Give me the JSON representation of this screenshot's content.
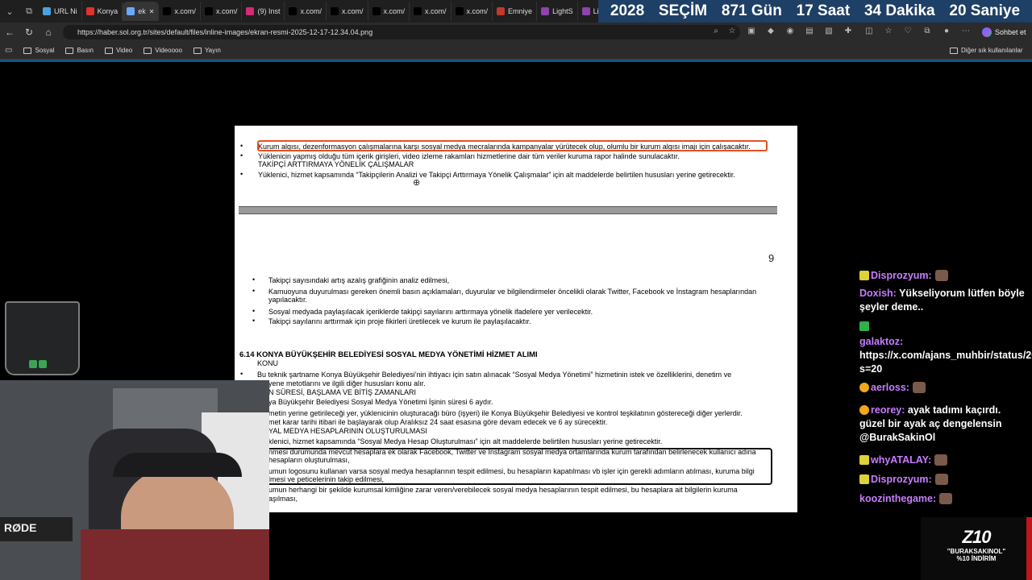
{
  "tabs": [
    {
      "label": "URL Ni",
      "color": "#4aa3df"
    },
    {
      "label": "Konya",
      "color": "#e0312e"
    },
    {
      "label": "ek",
      "color": "#6aa8ff",
      "active": true
    },
    {
      "label": "x.com/",
      "color": "#000000"
    },
    {
      "label": "x.com/",
      "color": "#000000"
    },
    {
      "label": "(9) Inst",
      "color": "#d62976"
    },
    {
      "label": "x.com/",
      "color": "#000000"
    },
    {
      "label": "x.com/",
      "color": "#000000"
    },
    {
      "label": "x.com/",
      "color": "#000000"
    },
    {
      "label": "x.com/",
      "color": "#000000"
    },
    {
      "label": "x.com/",
      "color": "#000000"
    },
    {
      "label": "Emniye",
      "color": "#c0392b"
    },
    {
      "label": "LightS",
      "color": "#8e44ad"
    },
    {
      "label": "LightS",
      "color": "#8e44ad"
    },
    {
      "label": "x",
      "color": "#8e44ad"
    }
  ],
  "countdown": {
    "year": "2028",
    "label": "SEÇİM",
    "days": "871 Gün",
    "hours": "17 Saat",
    "minutes": "34 Dakika",
    "seconds": "20 Saniye"
  },
  "url": "https://haber.sol.org.tr/sites/default/files/inline-images/ekran-resmi-2025-12-17-12.34.04.png",
  "chat_button": "Sohbet et",
  "bookmarks": {
    "items": [
      "Sosyal",
      "Basın",
      "Video",
      "Videoooo",
      "Yayın"
    ],
    "other": "Diğer sık kullanılanlar"
  },
  "doc": {
    "top_lines": [
      "Kurum algısı, dezenformasyon çalışmalarına karşı sosyal medya mecralarında kampanyalar yürütecek olup, olumlu bir kurum algısı imajı için çalışacaktır.",
      "Yüklenicin yapmış olduğu tüm içerik girişleri, video izleme rakamları hizmetlerine dair tüm veriler kuruma rapor halinde sunulacaktır.",
      "TAKİPÇİ ARTTIRMAYA YÖNELİK ÇALIŞMALAR",
      "Yüklenici, hizmet kapsamında “Takipçilerin Analizi ve Takipçi Arttırmaya Yönelik Çalışmalar” için alt maddelerde belirtilen hususları yerine getirecektir."
    ],
    "page_number": "9",
    "follower_items": [
      "Takipçi sayısındaki artış azalış grafiğinin analiz edilmesi,",
      "Kamuoyuna duyurulması gereken önemli basın açıklamaları, duyurular ve bilgilendirmeler öncelikli olarak Twitter, Facebook ve İnstagram hesaplarından",
      "yapılacaktır.",
      "Sosyal medyada paylaşılacak içeriklerde takipçi sayılarını arttırmaya yönelik ifadelere yer verilecektir.",
      "Takipçi sayılarını arttırmak için proje fikirleri üretilecek ve kurum ile paylaşılacaktır."
    ],
    "section_title": "6.14 KONYA BÜYÜKŞEHİR BELEDİYESİ SOSYAL MEDYA YÖNETİMİ HİZMET ALIMI",
    "section_lines": [
      "KONU",
      "Bu teknik şartname Konya Büyükşehir Belediyesi’nin ihtiyacı için satın alınacak “Sosyal Medya Yönetimi” hizmetinin istek ve özelliklerini, denetim ve",
      "yene metotlarını ve ilgili diğer hususları konu alır.",
      "N SÜRESİ, BAŞLAMA VE BİTİŞ ZAMANLARI",
      "ya Büyükşehir Belediyesi Sosyal Medya Yönetimi İşinin süresi 6 aydır.",
      "metin yerine getirileceği yer, yüklenicinin oluşturacağı büro (işyeri) ile Konya Büyükşehir Belediyesi ve kontrol teşkilatının göstereceği diğer yerlerdir.",
      "met karar tarihi itibari ile başlayarak olup Aralıksız 24 saat esasına göre devam edecek ve 6 ay sürecektir.",
      "YAL MEDYA HESAPLARININ OLUŞTURULMASI",
      "klenici, hizmet kapsamında “Sosyal Medya Hesap Oluşturulması” için alt maddelerde belirtilen hususları yerine getirecektir.",
      "nmesi durumunda mevcut hesaplara ek olarak Facebook, Twitter ve Instagram sosyal medya ortamlarında kurum tarafından belirlenecek kullanıcı adına",
      "hesapların oluşturulması,",
      "umun logosunu kullanan varsa sosyal medya hesaplarının tespit edilmesi, bu hesapların kapatılması vb işler için gerekli adımların atılması, kuruma bilgi",
      "lmesi ve peticelerinin takip edilmesi,",
      "umun herhangi bir şekilde kurumsal kimliğine zarar veren/verebilecek sosyal medya hesaplarının tespit edilmesi, bu hesaplara ait bilgilerin kuruma",
      "aşılması,"
    ]
  },
  "chat": [
    {
      "user": "Disprozyum:",
      "text": ""
    },
    {
      "user": "Doxish:",
      "text": " Yükseliyorum lütfen böyle şeyler deme.."
    },
    {
      "user": "",
      "text": ""
    },
    {
      "user": "galaktoz:",
      "text": " https://x.com/ajans_muhbir/status/2000963038997082589?s=20"
    },
    {
      "user": "aerloss:",
      "text": ""
    },
    {
      "user": "reorey:",
      "text": " ayak tadımı kaçırdı. güzel bir ayak aç dengelensin @BurakSakinOl"
    },
    {
      "user": "whyATALAY:",
      "text": ""
    },
    {
      "user": "Disprozyum:",
      "text": ""
    },
    {
      "user": "koozinthegame:",
      "text": ""
    }
  ],
  "promo": {
    "logo": "Z10",
    "line1": "\"BURAKSAKINOL\"",
    "line2": "%10 İNDİRİM"
  },
  "webcam": {
    "mic_label": "RØDE"
  },
  "colors": {
    "countdown_bg": "#1e3f66",
    "highlight_orange": "#e8501f",
    "chat_user": "#c77dff"
  }
}
